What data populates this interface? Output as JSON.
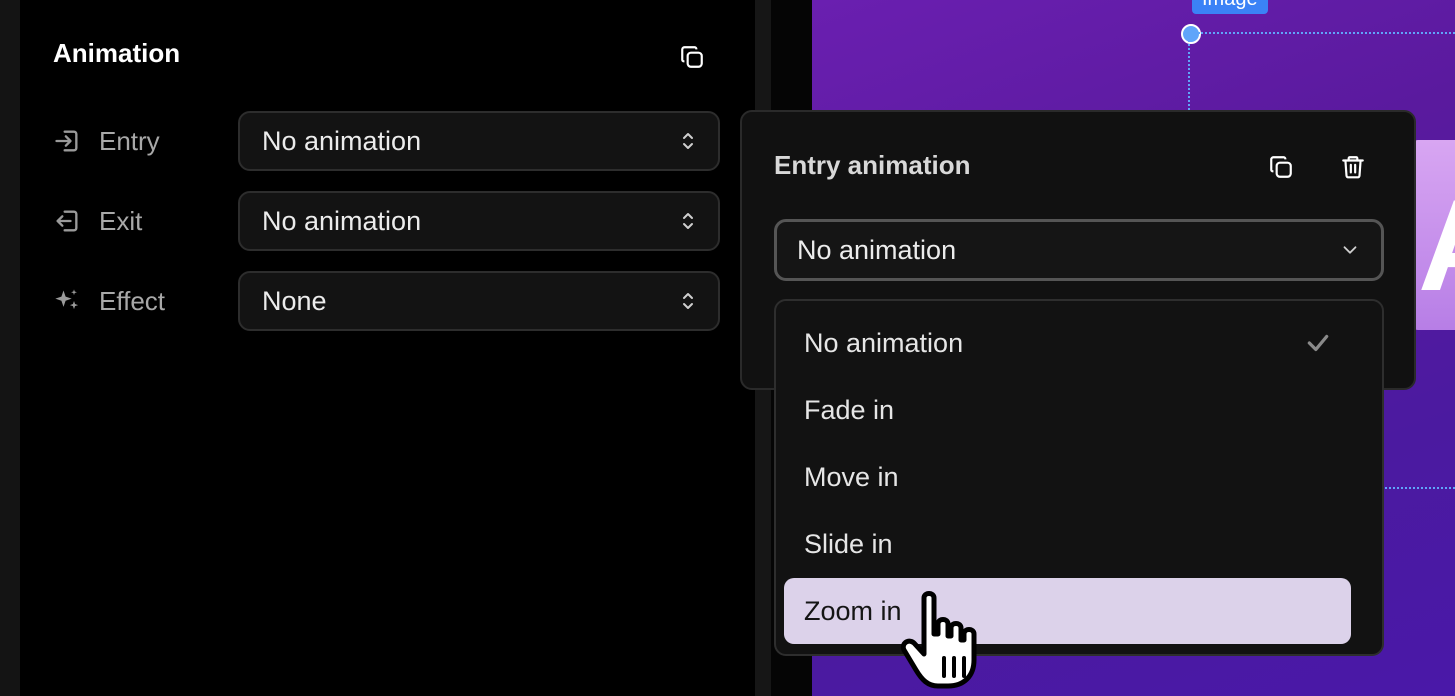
{
  "panel": {
    "title": "Animation",
    "rows": [
      {
        "label": "Entry",
        "value": "No animation",
        "icon": "entry-icon"
      },
      {
        "label": "Exit",
        "value": "No animation",
        "icon": "exit-icon"
      },
      {
        "label": "Effect",
        "value": "None",
        "icon": "sparkle-icon"
      }
    ]
  },
  "popover": {
    "title": "Entry animation",
    "selected": "No animation",
    "options": [
      {
        "label": "No animation",
        "checked": true
      },
      {
        "label": "Fade in",
        "checked": false
      },
      {
        "label": "Move in",
        "checked": false
      },
      {
        "label": "Slide in",
        "checked": false
      },
      {
        "label": "Zoom in",
        "checked": false,
        "hovered": true
      }
    ]
  },
  "canvas": {
    "element_label": "Image",
    "accent": "#3b82f6"
  },
  "colors": {
    "panel_bg": "#000000",
    "select_bg": "#131313",
    "hover_bg": "#dcd2ea"
  }
}
